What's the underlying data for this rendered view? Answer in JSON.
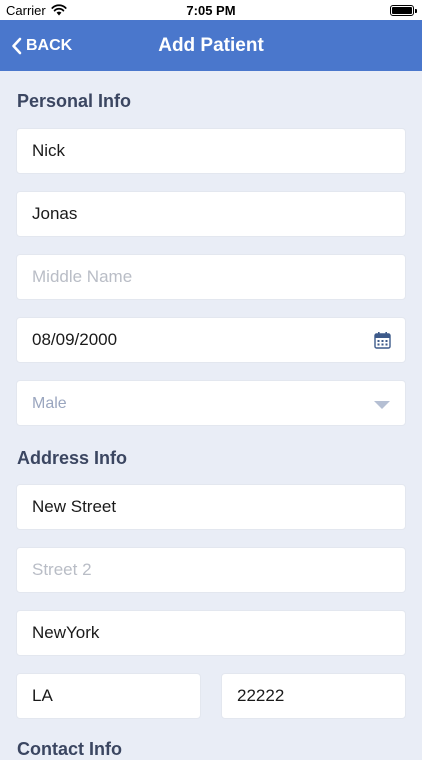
{
  "status": {
    "carrier": "Carrier",
    "time": "7:05 PM"
  },
  "nav": {
    "back_label": "BACK",
    "title": "Add Patient"
  },
  "personal": {
    "title": "Personal Info",
    "first_name": "Nick",
    "last_name": "Jonas",
    "middle_placeholder": "Middle Name",
    "dob": "08/09/2000",
    "gender": "Male"
  },
  "address": {
    "title": "Address Info",
    "street1": "New Street",
    "street2_placeholder": "Street 2",
    "city": "NewYork",
    "state": "LA",
    "zip": "22222"
  },
  "contact": {
    "title": "Contact Info"
  },
  "colors": {
    "navbar": "#4a77cc",
    "background": "#e9edf6",
    "section_title": "#3b4661"
  },
  "icons": {
    "back": "chevron-left-icon",
    "calendar": "calendar-icon",
    "dropdown": "caret-down-icon",
    "wifi": "wifi-icon",
    "battery": "battery-icon"
  }
}
